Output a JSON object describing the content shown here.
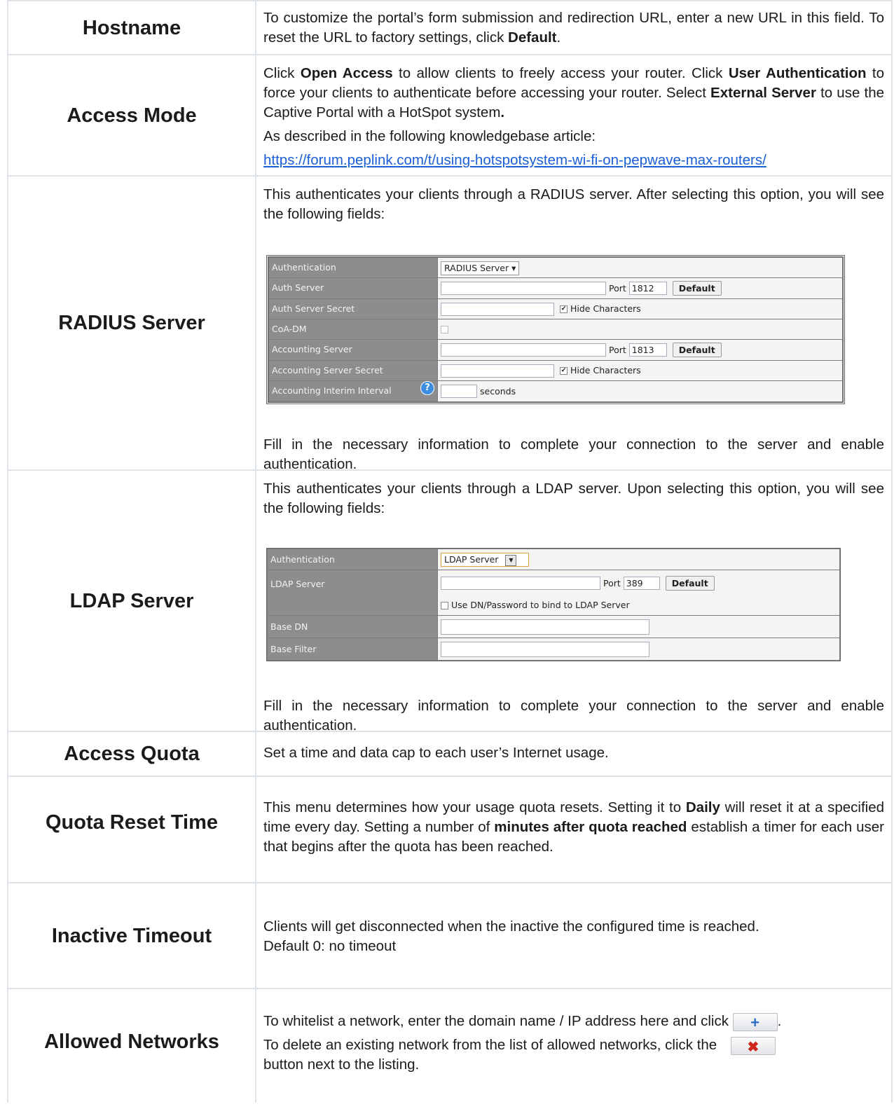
{
  "hostname": {
    "label": "Hostname",
    "text1": "To customize the portal’s form submission and redirection URL, enter a new URL in this field. To reset the URL to factory settings, click ",
    "bold1": "Default",
    "text2": "."
  },
  "access_mode": {
    "label": "Access Mode",
    "t1": "Click ",
    "b1": "Open Access",
    "t2": " to allow clients to freely access your router. Click ",
    "b2": "User Authentication",
    "t3": " to force your clients to authenticate before accessing your router. Select ",
    "b3": "External Server",
    "t4": " to use the Captive Portal with a HotSpot system",
    "b4": ".",
    "kb_text": "As described in the following knowledgebase article:",
    "link": "https://forum.peplink.com/t/using-hotspotsystem-wi-fi-on-pepwave-max-routers/"
  },
  "radius": {
    "label": "RADIUS Server",
    "intro": "This authenticates your clients through a RADIUS server. After selecting this option, you will see the following fields:",
    "outro": "Fill in the necessary information to complete your connection to the server and enable authentication.",
    "table": {
      "authentication_label": "Authentication",
      "authentication_value": "RADIUS Server",
      "auth_server_label": "Auth Server",
      "port_label": "Port",
      "auth_port": "1812",
      "default_label": "Default",
      "auth_secret_label": "Auth Server Secret",
      "hide_chars_label": "Hide Characters",
      "coa_label": "CoA-DM",
      "acct_server_label": "Accounting Server",
      "acct_port": "1813",
      "acct_secret_label": "Accounting Server Secret",
      "interim_label": "Accounting Interim Interval",
      "help_glyph": "?",
      "seconds_label": "seconds"
    }
  },
  "ldap": {
    "label": "LDAP Server",
    "intro": "This authenticates your clients through a LDAP server. Upon selecting this option, you will see the following fields:",
    "outro": "Fill in the necessary information to complete your connection to the server and enable authentication.",
    "table": {
      "authentication_label": "Authentication",
      "authentication_value": "LDAP Server",
      "ldap_server_label": "LDAP Server",
      "port_label": "Port",
      "port_value": "389",
      "default_label": "Default",
      "bind_label": "Use DN/Password to bind to LDAP Server",
      "base_dn_label": "Base DN",
      "base_filter_label": "Base Filter"
    }
  },
  "access_quota": {
    "label": "Access Quota",
    "text": "Set a time and data cap to each user’s Internet usage."
  },
  "quota_reset": {
    "label": "Quota Reset Time",
    "t1": "This menu determines how your usage quota resets. Setting it to ",
    "b1": "Daily",
    "t2": " will reset it at a specified time every day. Setting a number of ",
    "b2": "minutes after quota reached",
    "t3": " establish a timer for each user that begins after the quota has been reached."
  },
  "inactive": {
    "label": "Inactive Timeout",
    "line1": "Clients will get disconnected when the inactive the configured time is reached.",
    "line2": "Default 0: no timeout"
  },
  "allowed": {
    "label": "Allowed Networks",
    "line1": "To whitelist a network, enter the domain name / IP address here and click",
    "line1_end": ".",
    "line2": "To delete an existing network from the list of allowed networks, click the",
    "line3": "button next to the listing.",
    "colors": {
      "add": "#2f6fc7",
      "delete": "#d0271d"
    }
  }
}
